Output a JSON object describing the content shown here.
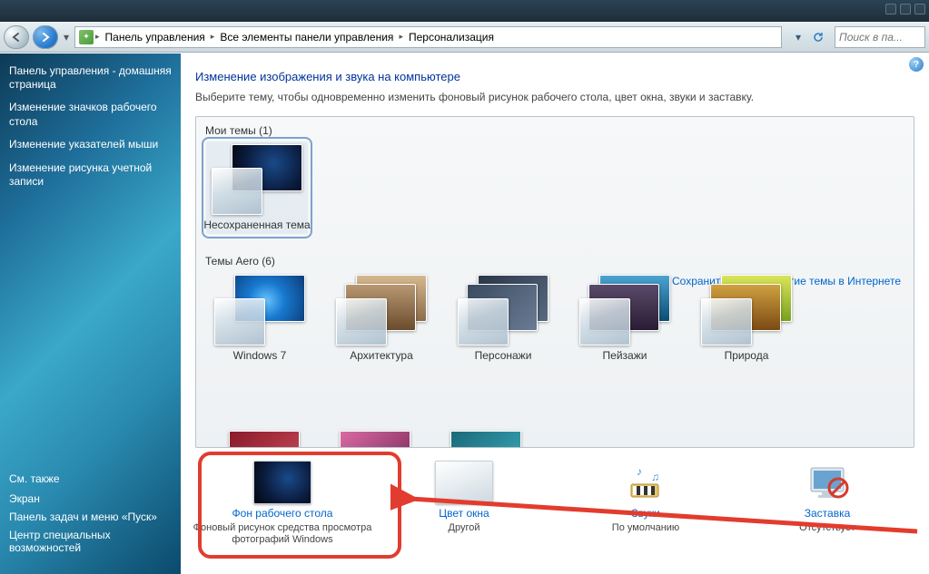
{
  "nav": {
    "path": [
      "Панель управления",
      "Все элементы панели управления",
      "Персонализация"
    ],
    "search_placeholder": "Поиск в па..."
  },
  "sidebar": {
    "home": "Панель управления - домашняя страница",
    "links": [
      "Изменение значков рабочего стола",
      "Изменение указателей мыши",
      "Изменение рисунка учетной записи"
    ],
    "see_also_label": "См. также",
    "see_also": [
      "Экран",
      "Панель задач и меню «Пуск»",
      "Центр специальных возможностей"
    ]
  },
  "hero": {
    "title": "Изменение изображения и звука на компьютере",
    "subtitle": "Выберите тему, чтобы одновременно изменить фоновый рисунок рабочего стола, цвет окна, звуки и заставку."
  },
  "themes": {
    "my_label": "Мои темы (1)",
    "my": [
      {
        "name": "Несохраненная тема",
        "selected": true
      }
    ],
    "save_link": "Сохранить тему",
    "more_link": "Другие темы в Интернете",
    "aero_label": "Темы Aero (6)",
    "aero": [
      {
        "name": "Windows 7"
      },
      {
        "name": "Архитектура"
      },
      {
        "name": "Персонажи"
      },
      {
        "name": "Пейзажи"
      },
      {
        "name": "Природа"
      }
    ]
  },
  "settings": {
    "background": {
      "link": "Фон рабочего стола",
      "desc": "Фоновый рисунок средства просмотра фотографий Windows"
    },
    "color": {
      "link": "Цвет окна",
      "desc": "Другой"
    },
    "sounds": {
      "link": "Звуки",
      "desc": "По умолчанию"
    },
    "saver": {
      "link": "Заставка",
      "desc": "Отсутствует"
    }
  }
}
